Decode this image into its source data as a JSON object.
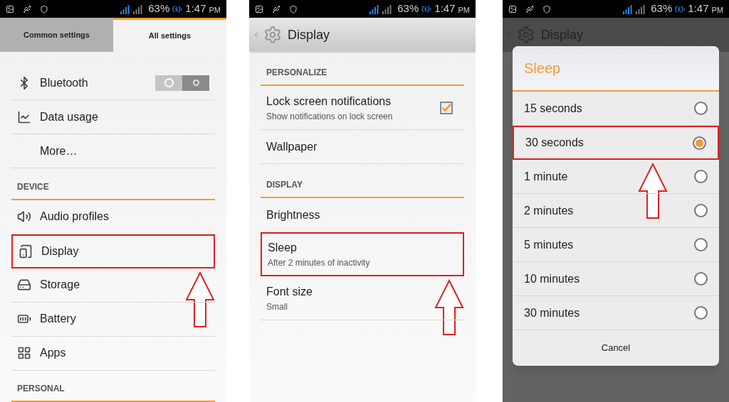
{
  "panels": [
    {
      "kind": "settings",
      "status_bar": {
        "battery": "63%",
        "time": "1:47",
        "meridiem": "PM"
      },
      "tabs": [
        {
          "label": "Common settings",
          "selected": false
        },
        {
          "label": "All settings",
          "selected": true
        }
      ],
      "items": [
        {
          "kind": "toggle",
          "label": "Bluetooth",
          "on": false,
          "highlighted": false
        },
        {
          "kind": "item",
          "label": "Data usage",
          "highlighted": false
        },
        {
          "kind": "item",
          "label": "More…",
          "highlighted": false
        },
        {
          "kind": "header",
          "label": "DEVICE"
        },
        {
          "kind": "item",
          "label": "Audio profiles",
          "highlighted": false
        },
        {
          "kind": "item",
          "label": "Display",
          "highlighted": true
        },
        {
          "kind": "item",
          "label": "Storage",
          "highlighted": false
        },
        {
          "kind": "item",
          "label": "Battery",
          "highlighted": false
        },
        {
          "kind": "item",
          "label": "Apps",
          "highlighted": false
        },
        {
          "kind": "header",
          "label": "PERSONAL"
        }
      ]
    },
    {
      "kind": "detail",
      "status_bar": {
        "battery": "63%",
        "time": "1:47",
        "meridiem": "PM"
      },
      "header": {
        "title": "Display"
      },
      "items": [
        {
          "kind": "header",
          "label": "PERSONALIZE"
        },
        {
          "kind": "checkbox",
          "label": "Lock screen notifications",
          "summary": "Show notifications on lock screen",
          "checked": true,
          "highlighted": false
        },
        {
          "kind": "item",
          "label": "Wallpaper",
          "highlighted": false
        },
        {
          "kind": "header",
          "label": "DISPLAY"
        },
        {
          "kind": "item",
          "label": "Brightness",
          "highlighted": false
        },
        {
          "kind": "item",
          "label": "Sleep",
          "summary": "After 2 minutes of inactivity",
          "highlighted": true
        },
        {
          "kind": "item",
          "label": "Font size",
          "summary": "Small",
          "highlighted": false
        }
      ]
    },
    {
      "kind": "dialog",
      "status_bar": {
        "battery": "63%",
        "time": "1:47",
        "meridiem": "PM"
      },
      "header": {
        "title": "Display"
      },
      "dialog": {
        "title": "Sleep",
        "button": "Cancel",
        "options": [
          {
            "label": "15 seconds",
            "selected": false,
            "highlighted": false
          },
          {
            "label": "30 seconds",
            "selected": true,
            "highlighted": true
          },
          {
            "label": "1 minute",
            "selected": false,
            "highlighted": false
          },
          {
            "label": "2 minutes",
            "selected": false,
            "highlighted": false
          },
          {
            "label": "5 minutes",
            "selected": false,
            "highlighted": false
          },
          {
            "label": "10 minutes",
            "selected": false,
            "highlighted": false
          },
          {
            "label": "30 minutes",
            "selected": false,
            "highlighted": false
          }
        ]
      }
    }
  ]
}
